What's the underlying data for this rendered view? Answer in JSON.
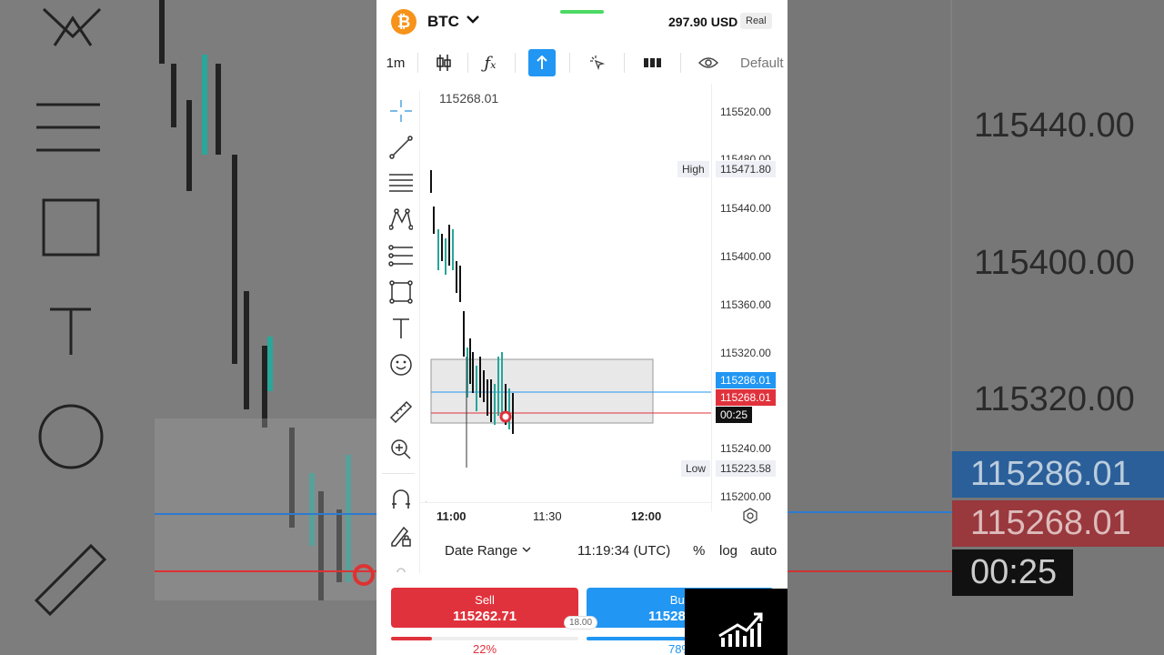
{
  "header": {
    "coin_glyph": "₿",
    "symbol": "BTC",
    "balance": "297.90 USD",
    "account_type": "Real"
  },
  "toolbar": {
    "timeframe": "1m",
    "default_label": "Default",
    "icons": [
      "candles-icon",
      "indicators-icon",
      "arrow-up-icon",
      "cursor-icon",
      "bars-icon",
      "eye-icon"
    ]
  },
  "chart": {
    "current_price_label": "115268.01",
    "axis_values": [
      "115520.00",
      "115480.00",
      "115440.00",
      "115400.00",
      "115360.00",
      "115320.00",
      "115240.00",
      "115200.00"
    ],
    "high_label": "High",
    "high_value": "115471.80",
    "low_label": "Low",
    "low_value": "115223.58",
    "bid_tag": "115286.01",
    "ask_tag": "115268.01",
    "timer": "00:25",
    "x_ticks": [
      "11:00",
      "11:30",
      "12:00"
    ],
    "colors": {
      "up": "#26a69a",
      "down": "#111111",
      "bid": "#2196f3",
      "ask": "#e0323c"
    }
  },
  "rangebar": {
    "date_range": "Date Range",
    "time": "11:19:34 (UTC)",
    "pct": "%",
    "log": "log",
    "auto": "auto"
  },
  "trade": {
    "sell_label": "Sell",
    "sell_price": "115262.71",
    "buy_label": "Buy",
    "buy_price": "115280.71",
    "spread": "18.00",
    "sell_pct": "22%",
    "buy_pct": "78%",
    "sell_ratio": 0.22,
    "buy_ratio": 0.78
  },
  "backdrop": {
    "prices": [
      "115440.00",
      "115400.00",
      "115360.00",
      "115320.00"
    ],
    "bid": "115286.01",
    "ask": "115268.01",
    "timer": "00:25"
  }
}
